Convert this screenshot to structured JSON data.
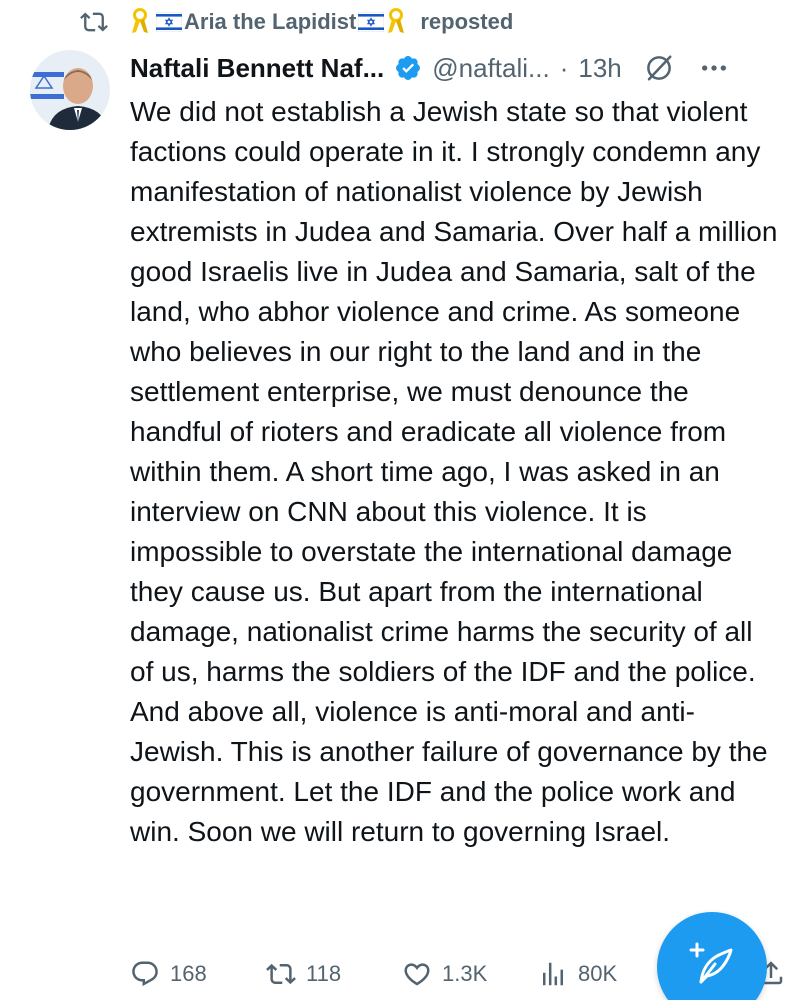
{
  "repost_banner": {
    "reposter_name": "Aria the Lapidist",
    "label": "reposted",
    "icons": [
      "repost-icon",
      "yellow-ribbon-icon",
      "israel-flag-icon",
      "israel-flag-icon",
      "yellow-ribbon-icon"
    ]
  },
  "tweet": {
    "author_name": "Naftali Bennett Naf...",
    "handle": "@naftali...",
    "separator": "·",
    "time": "13h",
    "verified_color": "#1d9bf0",
    "header_icons": [
      "verified-badge-icon",
      "grok-icon",
      "more-icon"
    ],
    "text": "We did not establish a Jewish state so that violent factions could operate in it. I strongly condemn any manifestation of nationalist violence by Jewish extremists in Judea and Samaria. Over half a million good Israelis live in Judea and Samaria, salt of the land, who abhor violence and crime. As someone who believes in our right to the land and in the settlement enterprise, we must denounce the handful of rioters and eradicate all violence from within them. A short time ago, I was asked in an interview on CNN about this violence. It is impossible to overstate the international damage they cause us. But apart from the international damage, nationalist crime harms the security of all of us, harms the soldiers of the IDF and the police. And above all, violence is anti-moral and anti-Jewish. This is another failure of governance by the government. Let the IDF and the police work and win. Soon we will return to governing Israel."
  },
  "actions": {
    "replies": "168",
    "reposts": "118",
    "likes": "1.3K",
    "views": "80K"
  },
  "colors": {
    "accent": "#1d9bf0",
    "secondary_text": "#536471",
    "primary_text": "#0f1419",
    "ribbon": "#f5c400"
  },
  "fab_icon": "compose-post-icon"
}
